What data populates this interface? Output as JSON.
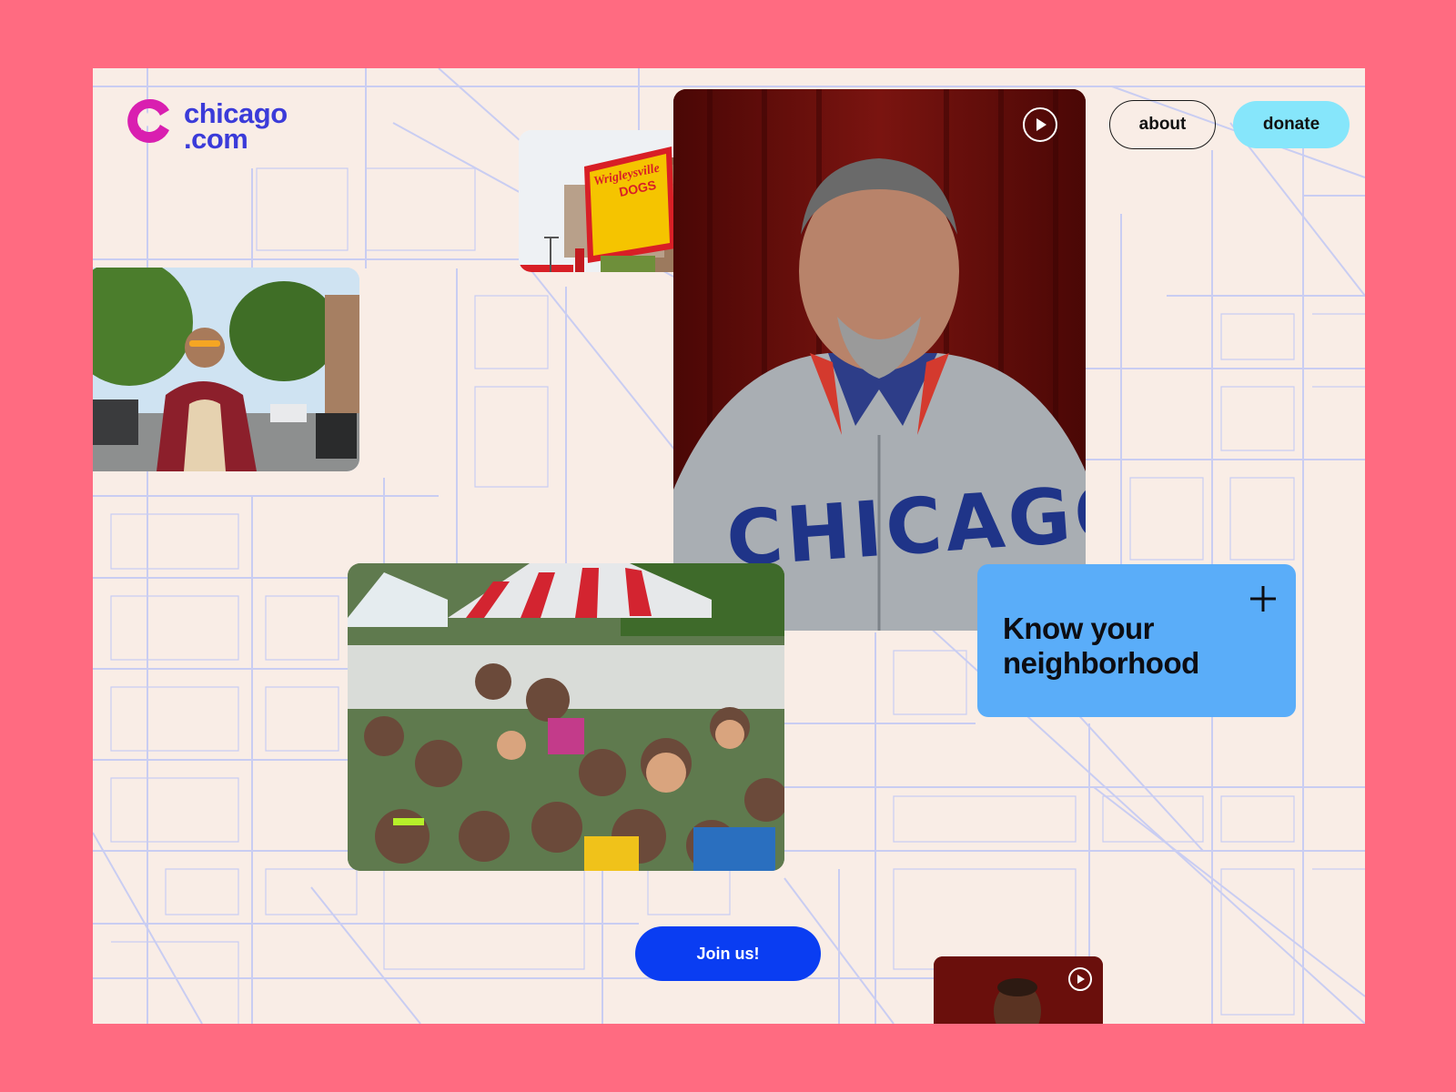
{
  "brand": {
    "name_line1": "chicago",
    "name_line2": ".com"
  },
  "nav": {
    "about_label": "about",
    "donate_label": "donate"
  },
  "feature_card": {
    "title": "Know your neighborhood"
  },
  "cta": {
    "join_label": "Join us!"
  },
  "photos": {
    "sign_text_line1": "Wrigleysville",
    "sign_text_line2": "DOGS",
    "jersey_text": "CHICAGO"
  },
  "colors": {
    "frame": "#ff6b81",
    "background": "#f9ede6",
    "map_lines": "#c9cdf2",
    "brand_blue": "#3b3bd9",
    "brand_magenta": "#d91fb0",
    "donate_bg": "#86e6fb",
    "card_bg": "#5aadf9",
    "join_bg": "#0a3df2"
  },
  "icons": [
    "star-logo-icon",
    "play-icon",
    "plus-icon"
  ]
}
